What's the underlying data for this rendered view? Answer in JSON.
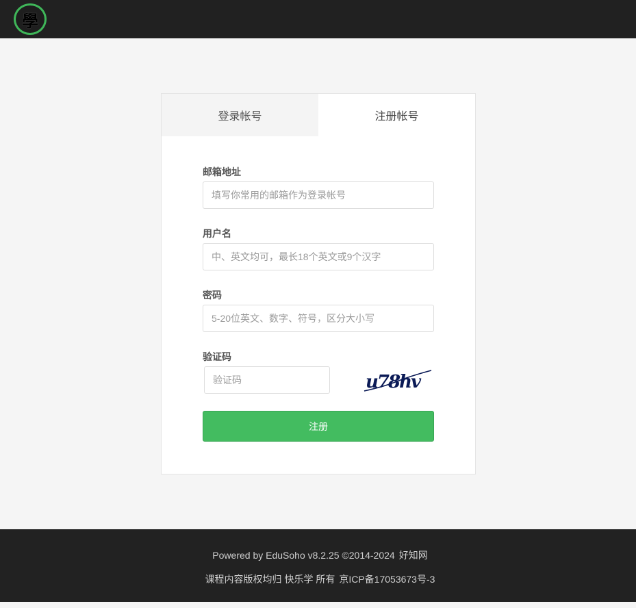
{
  "header": {
    "logo_char": "學",
    "brand_color": "#3fb659"
  },
  "tabs": [
    {
      "label": "登录帐号",
      "active": false
    },
    {
      "label": "注册帐号",
      "active": true
    }
  ],
  "form": {
    "email": {
      "label": "邮箱地址",
      "placeholder": "填写你常用的邮箱作为登录帐号"
    },
    "username": {
      "label": "用户名",
      "placeholder": "中、英文均可，最长18个英文或9个汉字"
    },
    "password": {
      "label": "密码",
      "placeholder": "5-20位英文、数字、符号，区分大小写"
    },
    "captcha": {
      "label": "验证码",
      "placeholder": "验证码",
      "image_text": "u78hv"
    },
    "submit_label": "注册",
    "submit_color": "#43bc60"
  },
  "footer": {
    "powered_by": "Powered by EduSoho v8.2.25 ©2014-2024",
    "site_link": "好知网",
    "copyright": "课程内容版权均归 快乐学 所有",
    "icp": "京ICP备17053673号-3"
  }
}
